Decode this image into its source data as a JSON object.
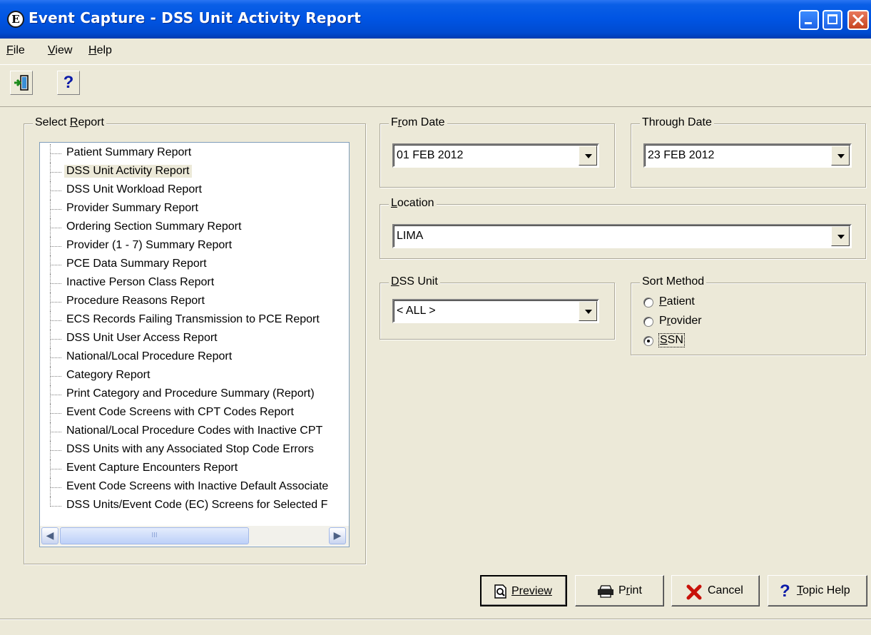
{
  "window": {
    "title": "Event Capture - DSS Unit Activity Report",
    "app_icon_glyph": "E"
  },
  "menu": [
    {
      "mnemonic": "F",
      "rest": "ile"
    },
    {
      "mnemonic": "V",
      "rest": "iew"
    },
    {
      "mnemonic": "H",
      "rest": "elp"
    }
  ],
  "toolbar": {
    "help_glyph": "?"
  },
  "select_report": {
    "label_pre": "Select ",
    "label_mnemonic": "R",
    "label_post": "eport",
    "items": [
      "Patient Summary Report",
      "DSS Unit Activity Report",
      "DSS Unit Workload Report",
      "Provider Summary Report",
      "Ordering Section Summary Report",
      "Provider (1 - 7) Summary Report",
      "PCE Data Summary Report",
      "Inactive Person Class Report",
      "Procedure Reasons Report",
      "ECS Records Failing Transmission to PCE Report",
      "DSS Unit User Access Report",
      "National/Local Procedure Report",
      "Category Report",
      "Print Category and Procedure Summary (Report)",
      "Event Code Screens with CPT Codes Report",
      "National/Local Procedure Codes with Inactive CPT",
      "DSS Units with any Associated Stop Code Errors",
      "Event Capture Encounters Report",
      "Event Code Screens with Inactive Default Associate",
      "DSS Units/Event Code (EC) Screens for Selected F"
    ],
    "selected_index": 1,
    "scroll_thumb_glyph": "III"
  },
  "from_date": {
    "label_pre": "F",
    "label_mnemonic": "r",
    "label_post": "om Date",
    "value": "01 FEB 2012"
  },
  "through_date": {
    "label": "Through Date",
    "value": "23 FEB 2012"
  },
  "location": {
    "label_mnemonic": "L",
    "label_post": "ocation",
    "value": "LIMA"
  },
  "dss_unit": {
    "label_mnemonic": "D",
    "label_post": "SS Unit",
    "value": "< ALL >"
  },
  "sort_method": {
    "label": "Sort Method",
    "options": [
      {
        "mnemonic": "P",
        "rest": "atient",
        "pre": ""
      },
      {
        "mnemonic": "r",
        "rest": "ovider",
        "pre": "P"
      },
      {
        "mnemonic": "S",
        "rest": "SN",
        "pre": ""
      }
    ],
    "selected": "SSN"
  },
  "buttons": {
    "preview": {
      "mnemonic": "",
      "label": "Preview"
    },
    "print": {
      "pre": "P",
      "mnemonic": "r",
      "rest": "int"
    },
    "cancel": {
      "label": "Cancel"
    },
    "topic_help": {
      "mnemonic": "T",
      "rest": "opic Help"
    }
  }
}
